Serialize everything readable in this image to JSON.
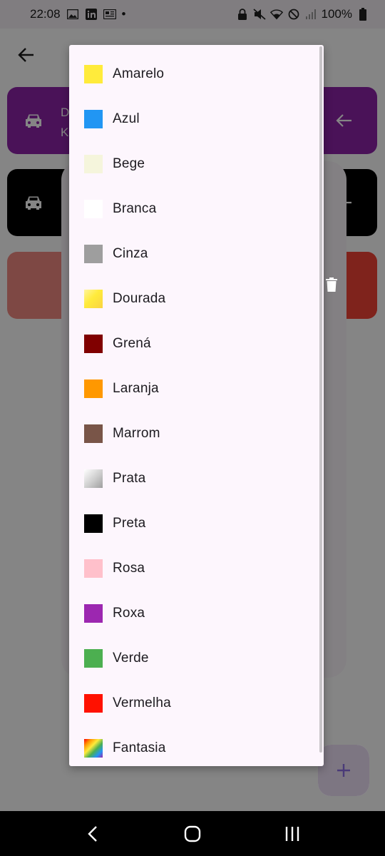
{
  "status_bar": {
    "time": "22:08",
    "battery": "100%",
    "dot": "•",
    "icons_left": [
      "image-icon",
      "linkedin-icon",
      "news-icon"
    ],
    "icons_right": [
      "lock-icon",
      "mute-icon",
      "wifi-icon",
      "dnd-icon",
      "signal-icon",
      "battery-icon"
    ]
  },
  "cards": [
    {
      "color": "#8e24aa",
      "title_initial": "D",
      "subtitle_initial": "K"
    },
    {
      "color": "#000000"
    },
    {
      "color": "#f44336"
    }
  ],
  "menu": {
    "items": [
      {
        "label": "Amarelo",
        "color": "#ffeb3b"
      },
      {
        "label": "Azul",
        "color": "#2196f3"
      },
      {
        "label": "Bege",
        "color": "#f5f5dc"
      },
      {
        "label": "Branca",
        "color": "#ffffff"
      },
      {
        "label": "Cinza",
        "color": "#9e9e9e"
      },
      {
        "label": "Dourada",
        "color": "gradient-gold"
      },
      {
        "label": "Grená",
        "color": "#800000"
      },
      {
        "label": "Laranja",
        "color": "#ff9800"
      },
      {
        "label": "Marrom",
        "color": "#795548"
      },
      {
        "label": "Prata",
        "color": "gradient-silver"
      },
      {
        "label": "Preta",
        "color": "#000000"
      },
      {
        "label": "Rosa",
        "color": "#ffc0cb"
      },
      {
        "label": "Roxa",
        "color": "#9c27b0"
      },
      {
        "label": "Verde",
        "color": "#4caf50"
      },
      {
        "label": "Vermelha",
        "color": "#ff1100"
      },
      {
        "label": "Fantasia",
        "color": "gradient-rainbow"
      }
    ]
  },
  "fab": {
    "icon": "plus-icon"
  },
  "nav": {
    "icons": [
      "back-nav-icon",
      "home-nav-icon",
      "recents-nav-icon"
    ]
  }
}
